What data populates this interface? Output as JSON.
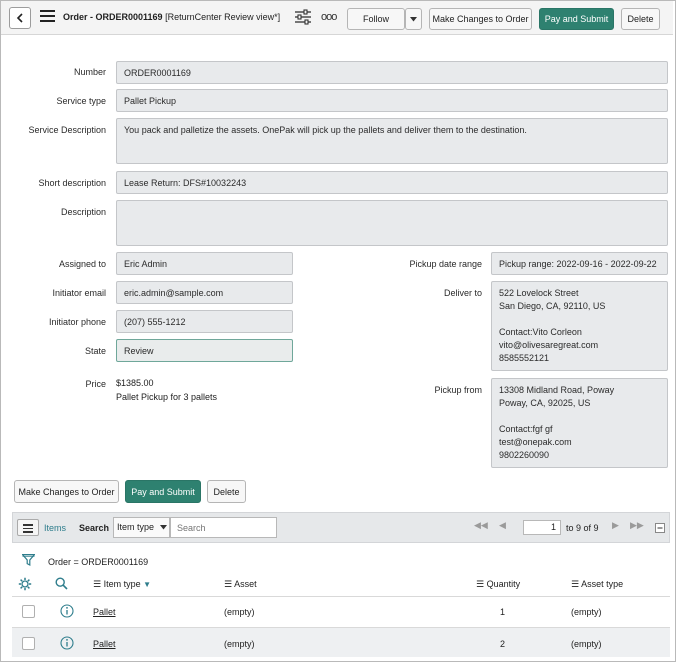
{
  "header": {
    "title_bold": "Order - ORDER0001169",
    "title_view": "[ReturnCenter Review view*]",
    "follow_label": "Follow",
    "make_changes_label": "Make Changes to Order",
    "pay_submit_label": "Pay and Submit",
    "delete_label": "Delete"
  },
  "form": {
    "number_label": "Number",
    "number_value": "ORDER0001169",
    "service_type_label": "Service type",
    "service_type_value": "Pallet Pickup",
    "service_description_label": "Service Description",
    "service_description_value": "You pack and palletize the assets.  OnePak will pick up the pallets and deliver them to the destination.",
    "short_description_label": "Short description",
    "short_description_value": "Lease Return: DFS#10032243",
    "description_label": "Description",
    "description_value": "",
    "assigned_to_label": "Assigned to",
    "assigned_to_value": "Eric Admin",
    "initiator_email_label": "Initiator email",
    "initiator_email_value": "eric.admin@sample.com",
    "initiator_phone_label": "Initiator phone",
    "initiator_phone_value": "(207) 555-1212",
    "state_label": "State",
    "state_value": "Review",
    "price_label": "Price",
    "price_value": "$1385.00",
    "price_note": "Pallet Pickup for 3 pallets",
    "pickup_date_label": "Pickup date range",
    "pickup_date_value": "Pickup range: 2022-09-16 - 2022-09-22",
    "deliver_to_label": "Deliver to",
    "deliver_to_lines": [
      "522 Lovelock Street",
      "San Diego, CA, 92110, US",
      "",
      "Contact:Vito Corleon",
      "vito@olivesaregreat.com",
      "8585552121"
    ],
    "pickup_from_label": "Pickup from",
    "pickup_from_lines": [
      "13308 Midland Road, Poway",
      "Poway, CA, 92025, US",
      "",
      "Contact:fgf gf",
      "test@onepak.com",
      "9802260090"
    ]
  },
  "actions": {
    "make_changes_label": "Make Changes to Order",
    "pay_submit_label": "Pay and Submit",
    "delete_label": "Delete"
  },
  "list": {
    "tab_label": "Items",
    "search_label": "Search",
    "field_select": "Item type",
    "search_placeholder": "Search",
    "page_value": "1",
    "page_total": "to 9 of 9",
    "filter_text": "Order = ORDER0001169",
    "columns": [
      "Item type",
      "Asset",
      "Quantity",
      "Asset type"
    ],
    "rows": [
      {
        "item_type": "Pallet",
        "asset": "(empty)",
        "quantity": "1",
        "asset_type": "(empty)"
      },
      {
        "item_type": "Pallet",
        "asset": "(empty)",
        "quantity": "2",
        "asset_type": "(empty)"
      }
    ]
  },
  "colors": {
    "accent": "#2e8170",
    "link_icon": "#2e7d8c"
  }
}
